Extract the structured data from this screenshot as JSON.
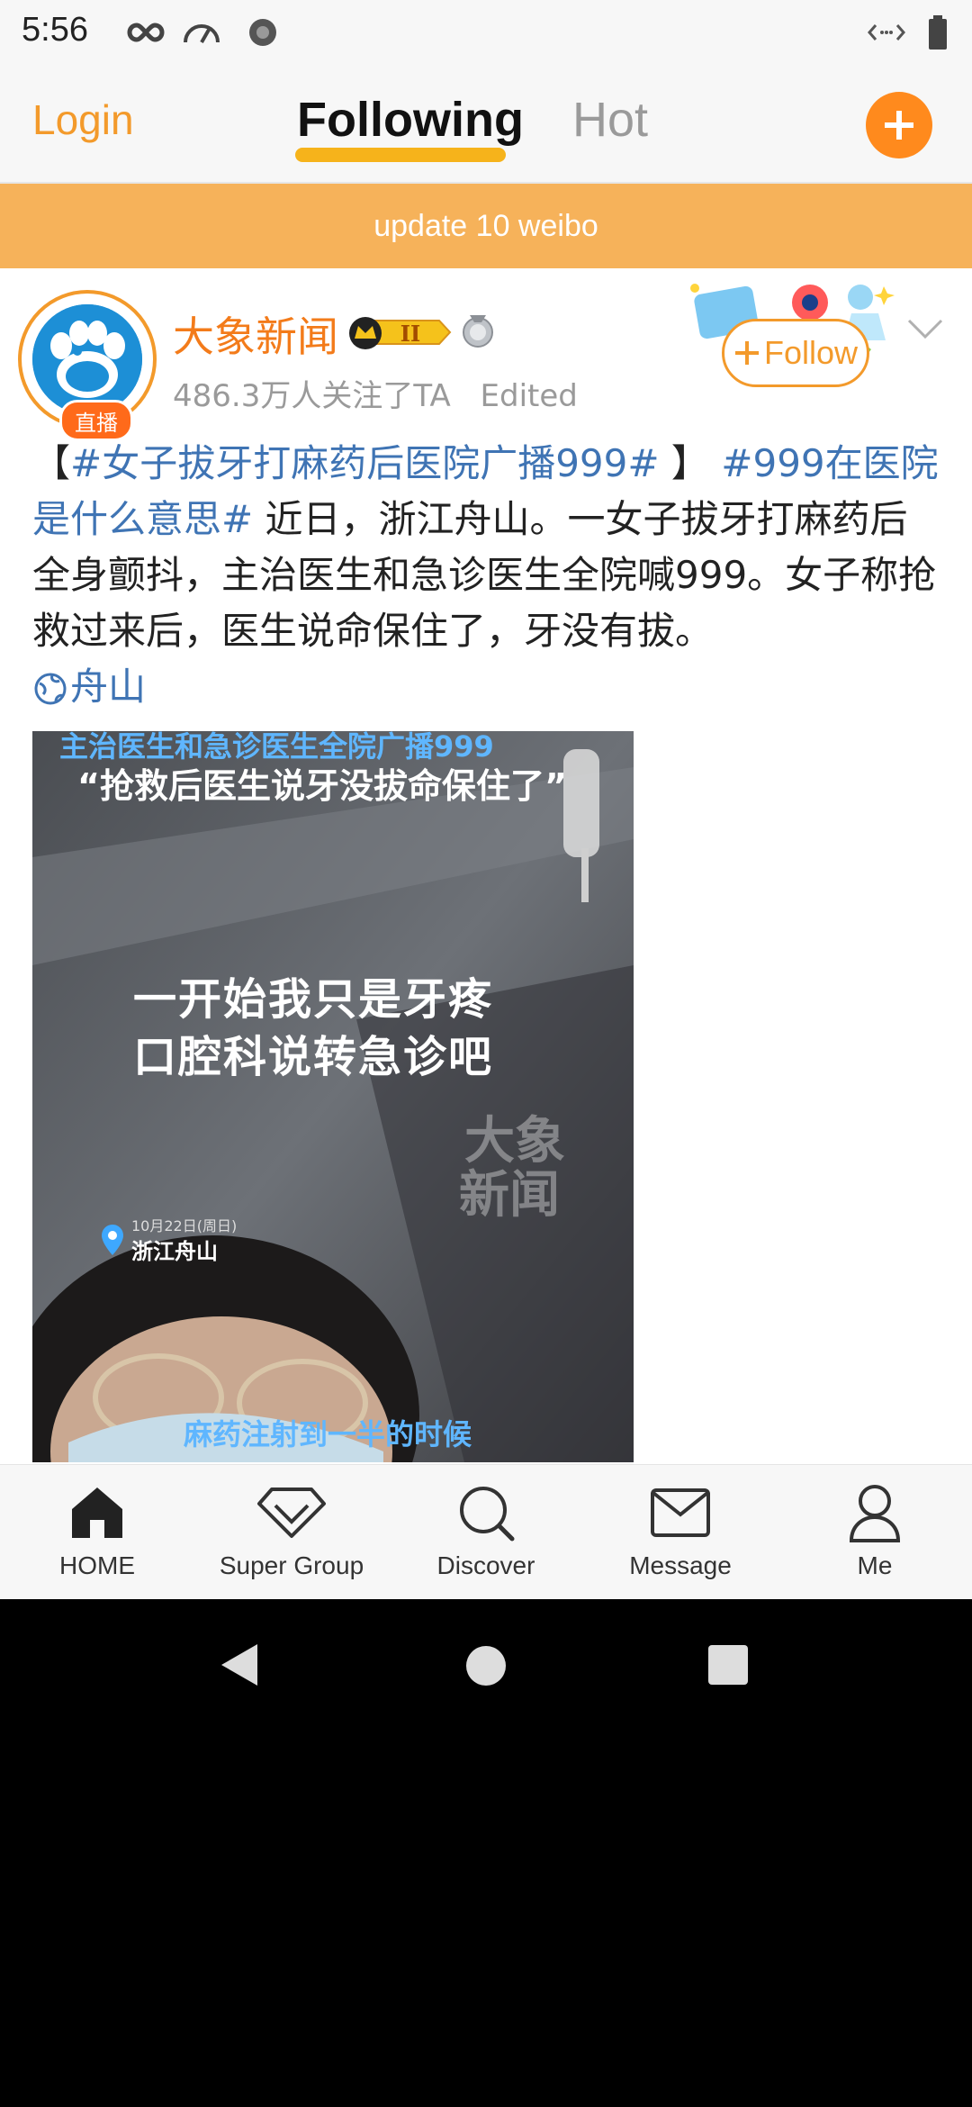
{
  "status_bar": {
    "time": "5:56"
  },
  "top_nav": {
    "login_label": "Login",
    "tabs": [
      {
        "label": "Following",
        "active": true
      },
      {
        "label": "Hot",
        "active": false
      }
    ],
    "compose_icon": "plus-icon"
  },
  "banner": {
    "text": "update 10 weibo"
  },
  "post": {
    "author": "大象新闻",
    "avatar_badge": "直播",
    "vip_level_badge": "vip-level-icon",
    "followers_text": "486.3万人关注了TA",
    "edited_label": "Edited",
    "follow_label": "Follow",
    "text": {
      "bracket_open": "【",
      "topic_1": "#女子拔牙打麻药后医院广播999#",
      "bracket_close": " 】",
      "topic_2": "#999在医院是什么意思#",
      "body": " 近日，浙江舟山。一女子拔牙打麻药后全身颤抖，主治医生和急诊医生全院喊999。女子称抢救过来后，医生说命保住了，牙没有拔。",
      "location": "舟山"
    },
    "media": {
      "caption_top_line1": "主治医生和急诊医生全院广播999",
      "caption_top_line2": "“抢救后医生说牙没拔命保住了”",
      "center_text_line1": "一开始我只是牙疼",
      "center_text_line2": "口腔科说转急诊吧",
      "watermark_line1": "大象",
      "watermark_line2": "新闻",
      "date_tag": "10月22日(周日)",
      "location_tag": "浙江舟山",
      "subtitle": "麻药注射到一半的时候"
    }
  },
  "bottom_nav": {
    "items": [
      {
        "label": "HOME",
        "icon": "home-icon"
      },
      {
        "label": "Super Group",
        "icon": "diamond-icon"
      },
      {
        "label": "Discover",
        "icon": "search-icon"
      },
      {
        "label": "Message",
        "icon": "envelope-icon"
      },
      {
        "label": "Me",
        "icon": "person-icon"
      }
    ]
  },
  "colors": {
    "accent": "#f39a2b",
    "banner": "#f6b25a",
    "topic_link": "#3f74b4",
    "tab_underline": "#f6b31b"
  }
}
